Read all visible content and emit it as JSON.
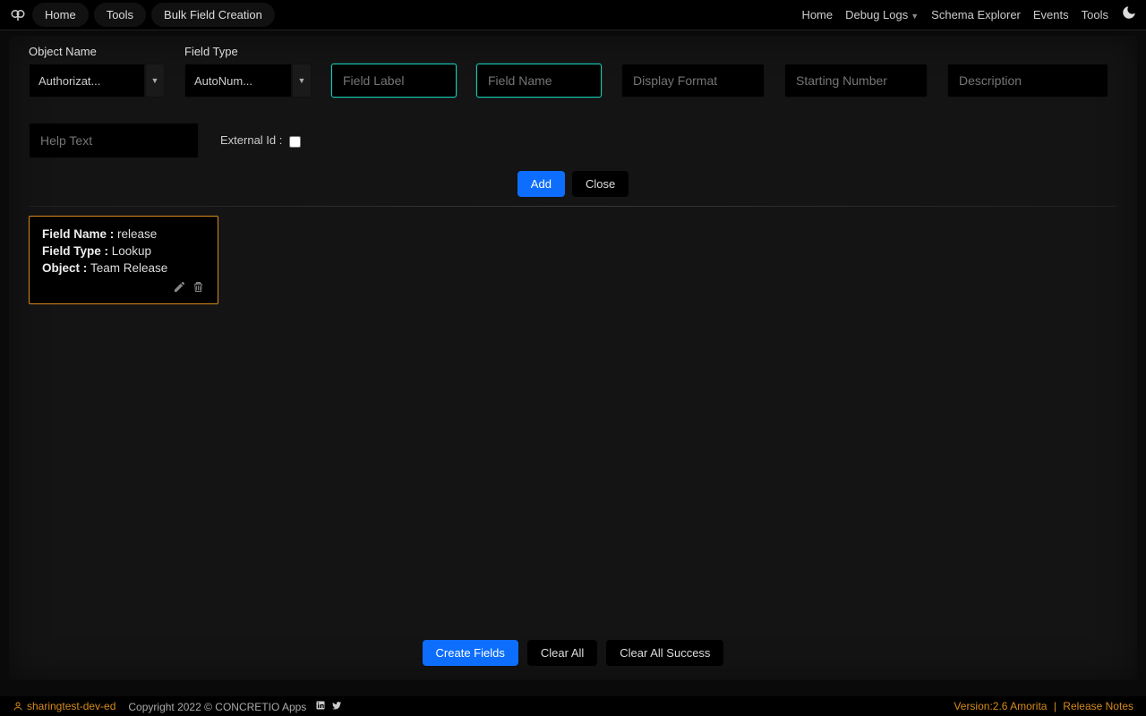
{
  "breadcrumbs": [
    "Home",
    "Tools",
    "Bulk Field Creation"
  ],
  "nav": {
    "home": "Home",
    "debug_logs": "Debug Logs",
    "schema_explorer": "Schema Explorer",
    "events": "Events",
    "tools": "Tools"
  },
  "form": {
    "object_name_label": "Object Name",
    "object_name_value": "Authorizat...",
    "field_type_label": "Field Type",
    "field_type_value": "AutoNum...",
    "field_label_ph": "Field Label",
    "field_name_ph": "Field Name",
    "display_format_ph": "Display Format",
    "starting_number_ph": "Starting Number",
    "description_ph": "Description",
    "help_text_ph": "Help Text",
    "external_id_label": "External Id :"
  },
  "buttons": {
    "add": "Add",
    "close": "Close",
    "create_fields": "Create Fields",
    "clear_all": "Clear All",
    "clear_all_success": "Clear All Success"
  },
  "card": {
    "field_name_label": "Field Name : ",
    "field_name_value": "release",
    "field_type_label": "Field Type : ",
    "field_type_value": "Lookup",
    "object_label": "Object : ",
    "object_value": "Team Release"
  },
  "footer": {
    "org": "sharingtest-dev-ed",
    "copyright": "Copyright 2022 © CONCRETIO Apps",
    "version": "Version:2.6 Amorita",
    "release_notes": "Release Notes"
  }
}
